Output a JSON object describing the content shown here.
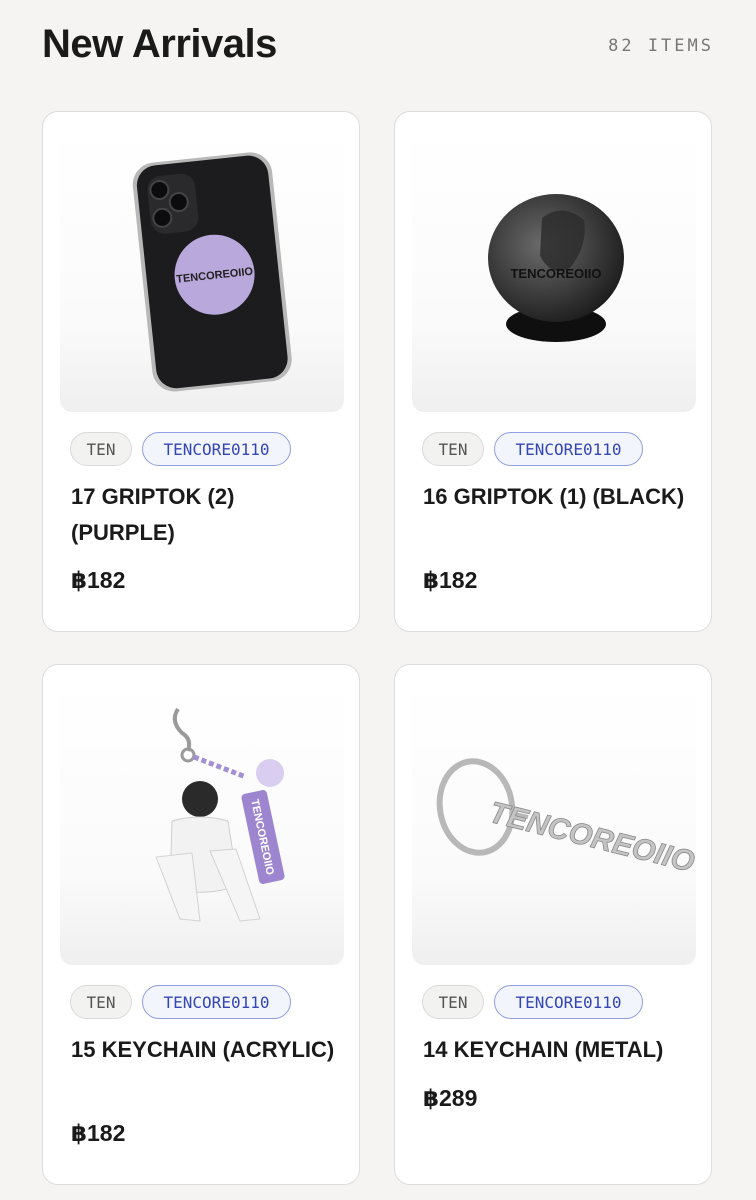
{
  "header": {
    "title": "New Arrivals",
    "count": "82 ITEMS"
  },
  "products": [
    {
      "name": "17 GRIPTOK (2) (PURPLE)",
      "price": "฿182",
      "tags": [
        "TEN",
        "TENCORE0110"
      ],
      "image_label": "TENCOREOIIO",
      "accent": "#b9a8dc"
    },
    {
      "name": "16 GRIPTOK (1) (BLACK)",
      "price": "฿182",
      "tags": [
        "TEN",
        "TENCORE0110"
      ],
      "image_label": "TENCOREOIIO",
      "accent": "#111111"
    },
    {
      "name": "15 KEYCHAIN (ACRYLIC)",
      "price": "฿182",
      "tags": [
        "TEN",
        "TENCORE0110"
      ],
      "image_label": "TENCOREOIIO",
      "accent": "#9d86cf"
    },
    {
      "name": "14 KEYCHAIN (METAL)",
      "price": "฿289",
      "tags": [
        "TEN",
        "TENCORE0110"
      ],
      "image_label": "TENCOREOIIO",
      "accent": "#c0c0c0"
    }
  ]
}
